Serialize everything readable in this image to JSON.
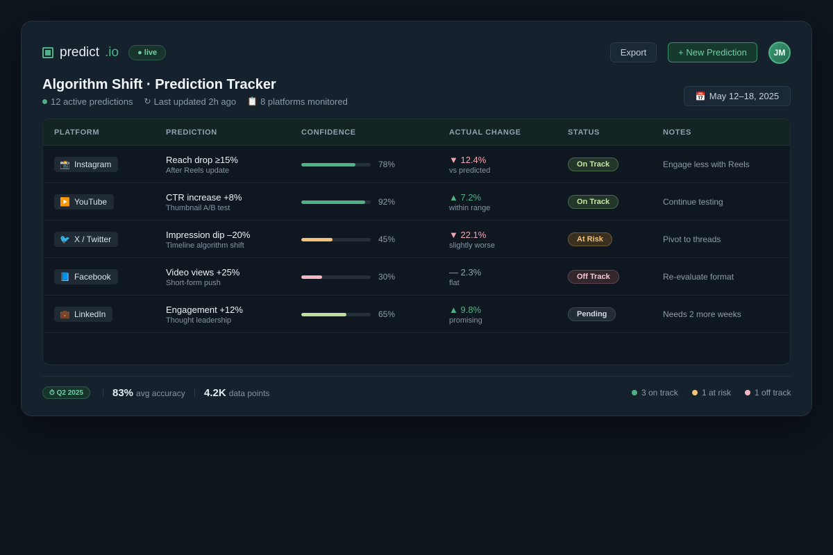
{
  "brand": {
    "name": "predict",
    "suffix": ".io",
    "live_badge": "● live",
    "icon": "square-logo-icon"
  },
  "header": {
    "export_label": "Export",
    "new_prediction_label": "+ New Prediction",
    "avatar_initials": "JM"
  },
  "page": {
    "title": "Algorithm Shift · Prediction Tracker",
    "meta": {
      "active": "12 active predictions",
      "updated_glyph": "↻",
      "updated": "Last updated 2h ago",
      "platforms_glyph": "📋",
      "platforms": "8 platforms monitored"
    },
    "date_glyph": "📅",
    "date_range": "May 12–18, 2025"
  },
  "table": {
    "headers": {
      "platform": "PLATFORM",
      "prediction": "PREDICTION",
      "confidence": "CONFIDENCE",
      "actual_change": "ACTUAL CHANGE",
      "status": "STATUS",
      "notes": "NOTES"
    },
    "rows": [
      {
        "platform_icon": "📸",
        "platform": "Instagram",
        "prediction": "Reach drop ≥15%",
        "prediction_sub": "After Reels update",
        "confidence": 78,
        "confidence_label": "78%",
        "confidence_color": "#4fb286",
        "change": "▼ 12.4%",
        "change_color": "#f2a7b5",
        "change_sub": "vs predicted",
        "status": "On Track",
        "status_bg": "#24352a",
        "status_border": "#4a6b4a",
        "status_color": "#c7e6a3",
        "note": "Engage less with Reels"
      },
      {
        "platform_icon": "▶️",
        "platform": "YouTube",
        "prediction": "CTR increase +8%",
        "prediction_sub": "Thumbnail A/B test",
        "confidence": 92,
        "confidence_label": "92%",
        "confidence_color": "#4fb286",
        "change": "▲ 7.2%",
        "change_color": "#4fb286",
        "change_sub": "within range",
        "status": "On Track",
        "status_bg": "#24352a",
        "status_border": "#4a6b4a",
        "status_color": "#c7e6a3",
        "note": "Continue testing"
      },
      {
        "platform_icon": "🐦",
        "platform": "X / Twitter",
        "prediction": "Impression dip –20%",
        "prediction_sub": "Timeline algorithm shift",
        "confidence": 45,
        "confidence_label": "45%",
        "confidence_color": "#f5c27a",
        "change": "▼ 22.1%",
        "change_color": "#f2a7b5",
        "change_sub": "slightly worse",
        "status": "At Risk",
        "status_bg": "#3a3020",
        "status_border": "#6b5a33",
        "status_color": "#f5c27a",
        "note": "Pivot to threads"
      },
      {
        "platform_icon": "📘",
        "platform": "Facebook",
        "prediction": "Video views +25%",
        "prediction_sub": "Short-form push",
        "confidence": 30,
        "confidence_label": "30%",
        "confidence_color": "#f5b6c4",
        "change": "— 2.3%",
        "change_color": "#8fa2b1",
        "change_sub": "flat",
        "status": "Off Track",
        "status_bg": "#33262c",
        "status_border": "#5c4450",
        "status_color": "#f5c9d3",
        "note": "Re-evaluate format"
      },
      {
        "platform_icon": "💼",
        "platform": "LinkedIn",
        "prediction": "Engagement +12%",
        "prediction_sub": "Thought leadership",
        "confidence": 65,
        "confidence_label": "65%",
        "confidence_color": "#bfe09a",
        "change": "▲ 9.8%",
        "change_color": "#4fb286",
        "change_sub": "promising",
        "status": "Pending",
        "status_bg": "#222b36",
        "status_border": "#3b4855",
        "status_color": "#d2dbe3",
        "note": "Needs 2 more weeks"
      }
    ]
  },
  "footer": {
    "quarter": "⏱ Q2 2025",
    "accuracy_value": "83%",
    "accuracy_label": "avg accuracy",
    "points_value": "4.2K",
    "points_label": "data points",
    "legend": [
      {
        "label": "3 on track",
        "color": "#4fb286"
      },
      {
        "label": "1 at risk",
        "color": "#f5c27a"
      },
      {
        "label": "1 off track",
        "color": "#f5b6c4"
      }
    ]
  }
}
